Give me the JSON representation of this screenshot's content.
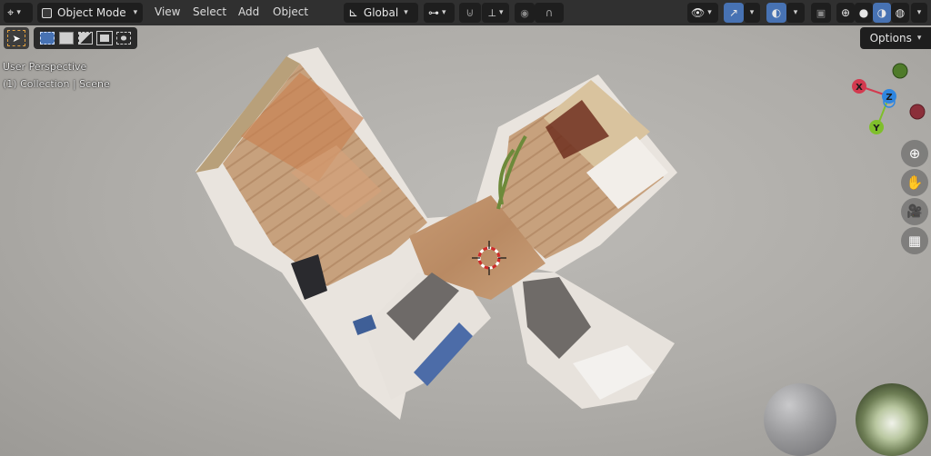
{
  "header": {
    "editor_icon": "editor-type-icon",
    "mode_label": "Object Mode",
    "menus": [
      "View",
      "Select",
      "Add",
      "Object"
    ],
    "transform_orientation": "Global",
    "options_label": "Options"
  },
  "overlay": {
    "perspective": "User Perspective",
    "collection": "(1) Collection | Scene"
  },
  "gizmo": {
    "x_label": "X",
    "y_label": "Y",
    "z_label": "Z",
    "colors": {
      "x": "#d33a4f",
      "y": "#7fbf2b",
      "z": "#2f86e0",
      "neg_x": "#8b2f3a",
      "neg_y": "#4f7b2a"
    }
  },
  "nav_buttons": [
    "zoom-icon",
    "hand-pan-icon",
    "camera-icon",
    "grid-perspective-icon"
  ],
  "accent_color": "#4772b3"
}
